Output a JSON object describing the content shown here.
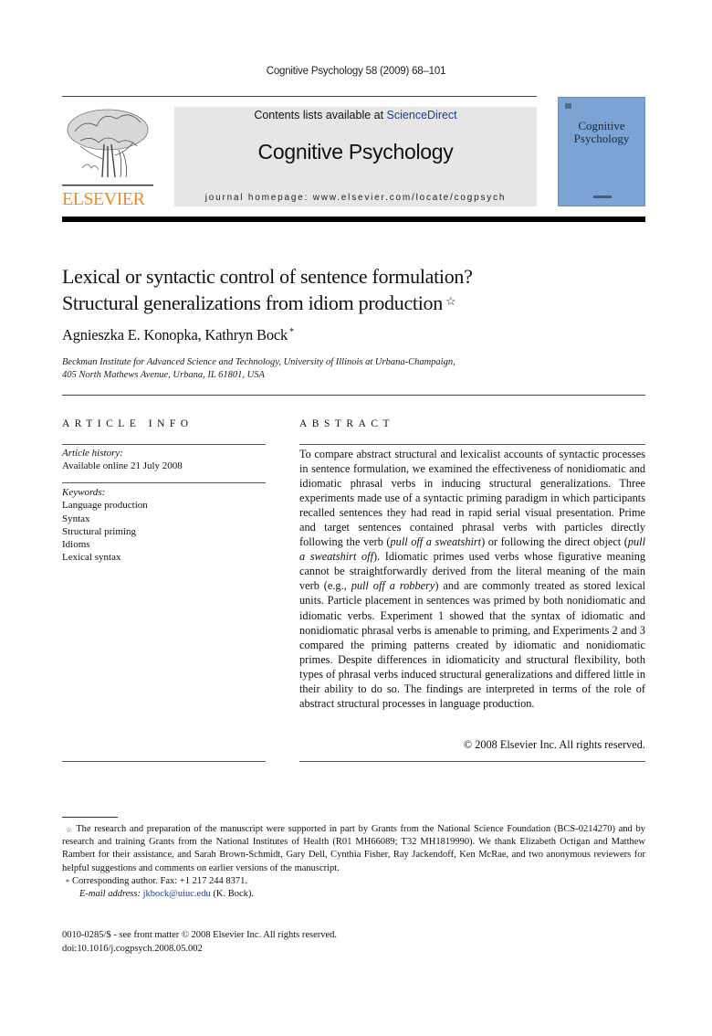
{
  "running_head": "Cognitive Psychology 58 (2009) 68–101",
  "masthead": {
    "publisher_logo_text": "ELSEVIER",
    "contents_prefix": "Contents lists available at ",
    "contents_link": "ScienceDirect",
    "journal_title": "Cognitive Psychology",
    "homepage": "journal homepage: www.elsevier.com/locate/cogpsych",
    "cover_title_line1": "Cognitive",
    "cover_title_line2": "Psychology"
  },
  "colors": {
    "elsevier_orange": "#f08a24",
    "link_blue": "#1b3d92",
    "masthead_gray": "#e6e6e6",
    "cover_blue": "#7ba3d3"
  },
  "article": {
    "title_line1": "Lexical or syntactic control of sentence formulation?",
    "title_line2": "Structural generalizations from idiom production",
    "title_mark": "☆",
    "authors": "Agnieszka E. Konopka, Kathryn Bock",
    "author_mark": "*",
    "affiliation_line1": "Beckman Institute for Advanced Science and Technology, University of Illinois at Urbana-Champaign,",
    "affiliation_line2": "405 North Mathews Avenue, Urbana, IL 61801, USA"
  },
  "article_info": {
    "heading": "ARTICLE INFO",
    "history_label": "Article history:",
    "history_value": "Available online 21 July 2008",
    "keywords_label": "Keywords:",
    "keywords": [
      "Language production",
      "Syntax",
      "Structural priming",
      "Idioms",
      "Lexical syntax"
    ]
  },
  "abstract": {
    "heading": "ABSTRACT",
    "p1": "To compare abstract structural and lexicalist accounts of syntactic processes in sentence formulation, we examined the effectiveness of nonidiomatic and idiomatic phrasal verbs in inducing structural generalizations. Three experiments made use of a syntactic prim­ing paradigm in which participants recalled sentences they had read in rapid serial visual presentation. Prime and target sentences contained phrasal verbs with particles directly following the verb (",
    "ex1": "pull off a sweatshirt",
    "p2": ") or following the direct object (",
    "ex2": "pull a sweatshirt off",
    "p3": "). Idiomatic primes used verbs whose figurative meaning cannot be straightforwardly derived from the literal meaning of the main verb (e.g., ",
    "ex3": "pull off a robbery",
    "p4": ") and are commonly treated as stored lexical units. Particle placement in sentences was primed by both nonidiomatic and idiomatic verbs. Experiment 1 showed that the syntax of idiomatic and nonidiomatic phrasal verbs is amenable to priming, and Experiments 2 and 3 compared the priming pat­terns created by idiomatic and nonidiomatic primes. Despite differ­ences in idiomaticity and structural flexibility, both types of phrasal verbs induced structural generalizations and differed little in their ability to do so. The findings are interpreted in terms of the role of abstract structural processes in language production.",
    "copyright": "© 2008 Elsevier Inc. All rights reserved."
  },
  "footnotes": {
    "star_mark": "☆",
    "funding": "The research and preparation of the manuscript were supported in part by Grants from the National Science Foundation (BCS-0214270) and by research and training Grants from the National Institutes of Health (R01 MH66089; T32 MH1819990). We thank Elizabeth Octigan and Matthew Rambert for their assistance, and Sarah Brown-Schmidt, Gary Dell, Cynthia Fisher, Ray Jackendoff, Ken McRae, and two anonymous reviewers for helpful suggestions and comments on earlier versions of the manuscript.",
    "corr_mark": "*",
    "corresponding": "Corresponding author. Fax: +1 217 244 8371.",
    "email_label": "E-mail address:",
    "email": "jkbock@uiuc.edu",
    "email_suffix": " (K. Bock)."
  },
  "front_matter": {
    "line1": "0010-0285/$ - see front matter © 2008 Elsevier Inc. All rights reserved.",
    "doi": "doi:10.1016/j.cogpsych.2008.05.002"
  }
}
